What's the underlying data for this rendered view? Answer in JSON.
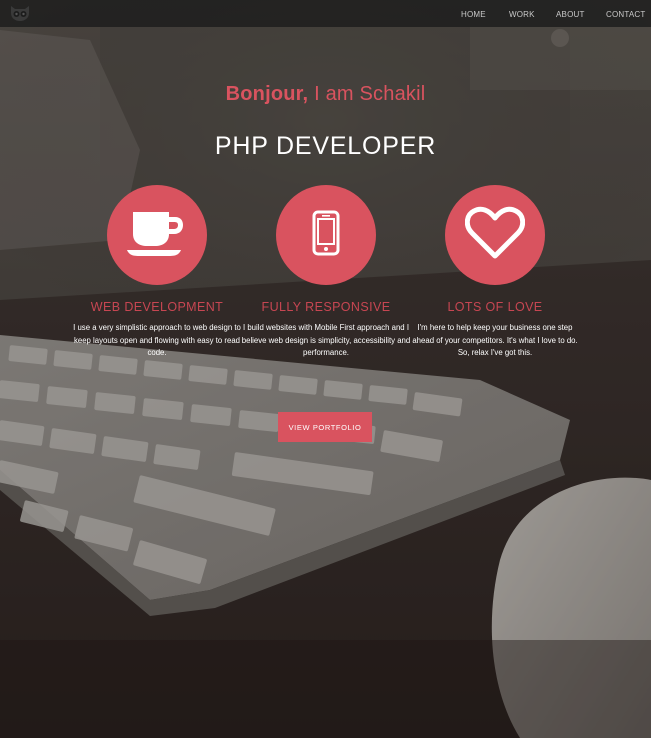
{
  "colors": {
    "accent": "#d9535f",
    "navbar": "#1c1c1c",
    "text_light": "#ffffff",
    "nav_text": "#c9c9c9"
  },
  "navbar": {
    "logo_icon": "owl-logo-icon",
    "items": [
      {
        "label": "HOME"
      },
      {
        "label": "WORK"
      },
      {
        "label": "ABOUT"
      },
      {
        "label": "CONTACT"
      }
    ]
  },
  "hero": {
    "greeting_hello": "Bonjour,",
    "greeting_rest": " I am Schakil",
    "title": "PHP DEVELOPER"
  },
  "features": [
    {
      "icon": "coffee-cup-icon",
      "title": "WEB DEVELOPMENT",
      "text": "I use a very simplistic approach to web design to keep layouts open and flowing with easy to read code."
    },
    {
      "icon": "smartphone-icon",
      "title": "FULLY RESPONSIVE",
      "text": "I build websites with Mobile First approach and I believe web design is simplicity, accessibility and performance."
    },
    {
      "icon": "heart-icon",
      "title": "LOTS OF LOVE",
      "text": "I'm here to help keep your business one step ahead of your competitors. It's what I love to do. So, relax I've got this."
    }
  ],
  "cta": {
    "label": "VIEW PORTFOLIO"
  }
}
